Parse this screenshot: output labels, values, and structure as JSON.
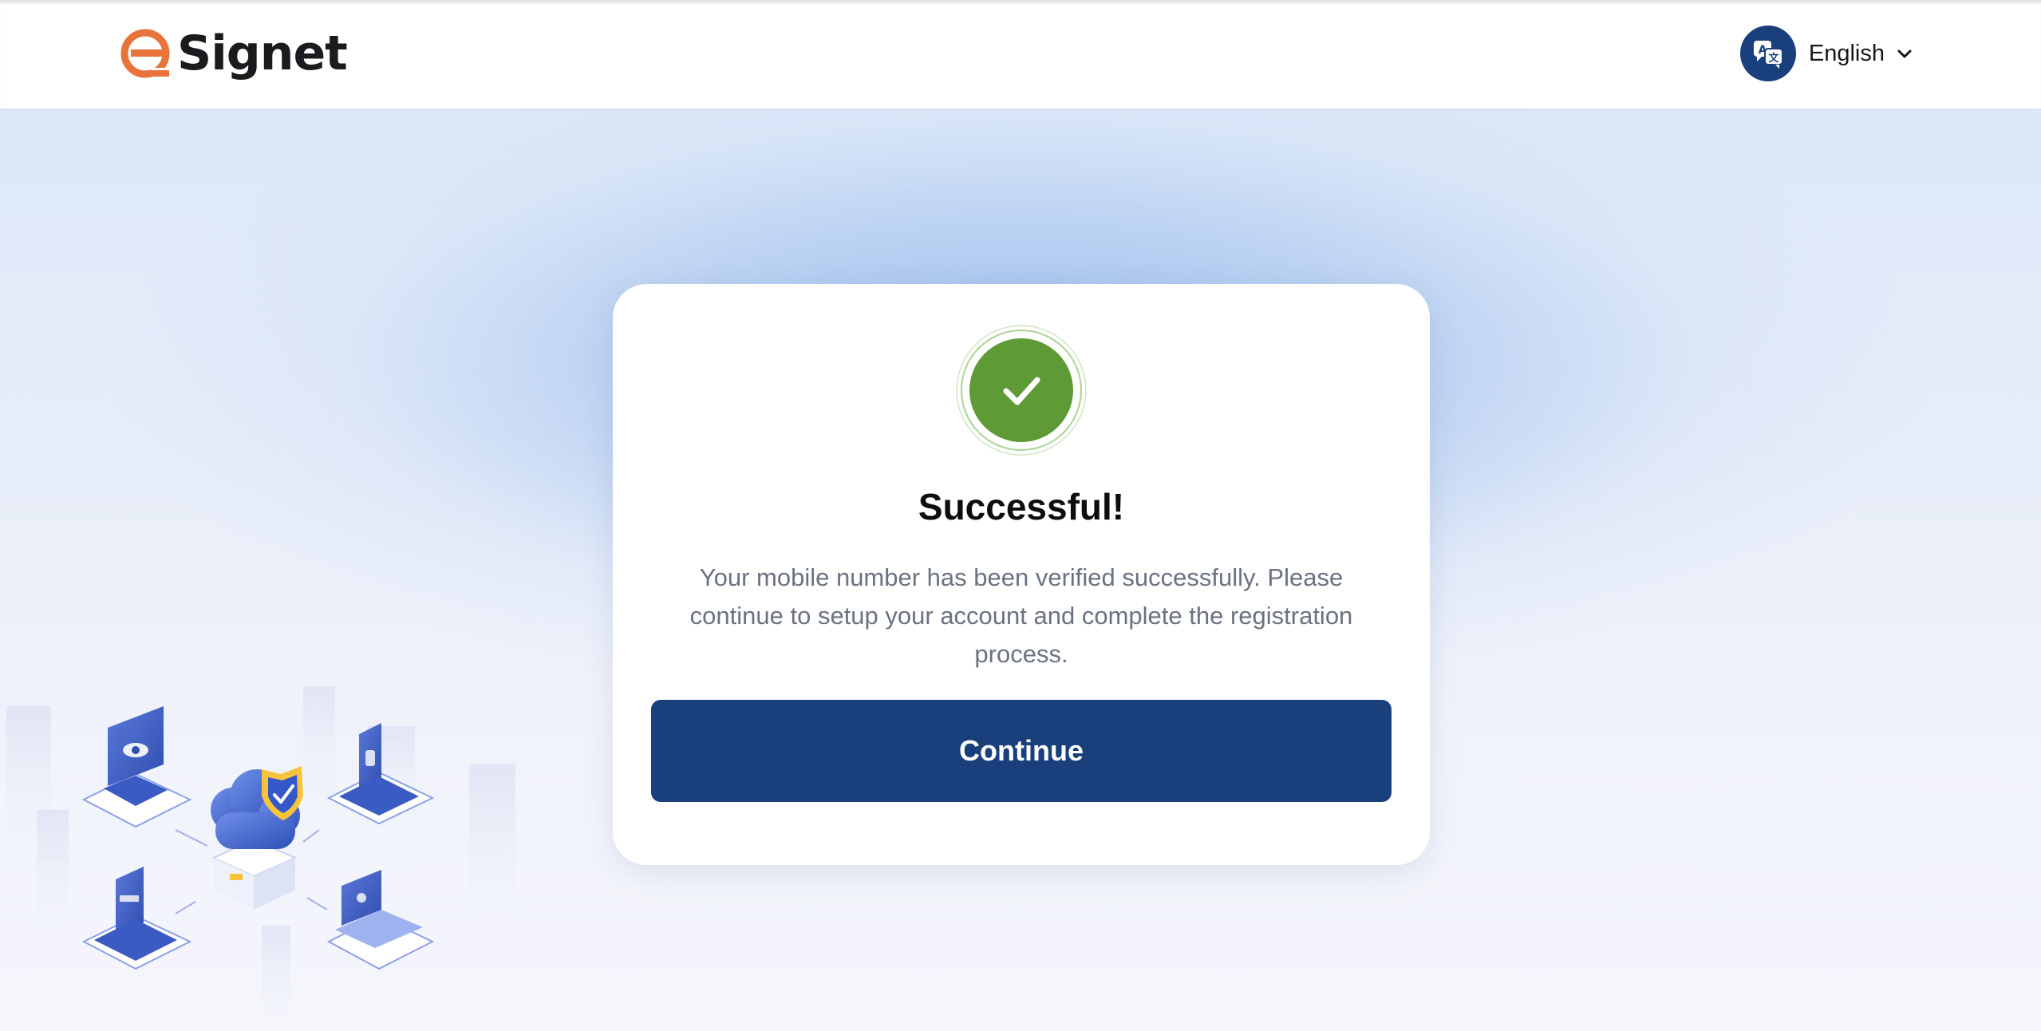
{
  "header": {
    "brand_name": "Signet",
    "logo_icon": "signet-e-logo-icon",
    "language": {
      "label": "English",
      "icon": "translate-icon",
      "chevron": "chevron-down-icon"
    }
  },
  "card": {
    "status_icon": "check-circle-icon",
    "title": "Successful!",
    "message": "Your mobile number has been verified successfully. Please continue to setup your account and complete the registration process.",
    "continue_label": "Continue"
  },
  "colors": {
    "brand_orange": "#e8743b",
    "primary_navy": "#1a3f7d",
    "success_green": "#5e9a35",
    "text_dark": "#0d0d10",
    "text_muted": "#6b7280"
  },
  "illustration": {
    "icon": "cloud-security-network-illustration"
  }
}
